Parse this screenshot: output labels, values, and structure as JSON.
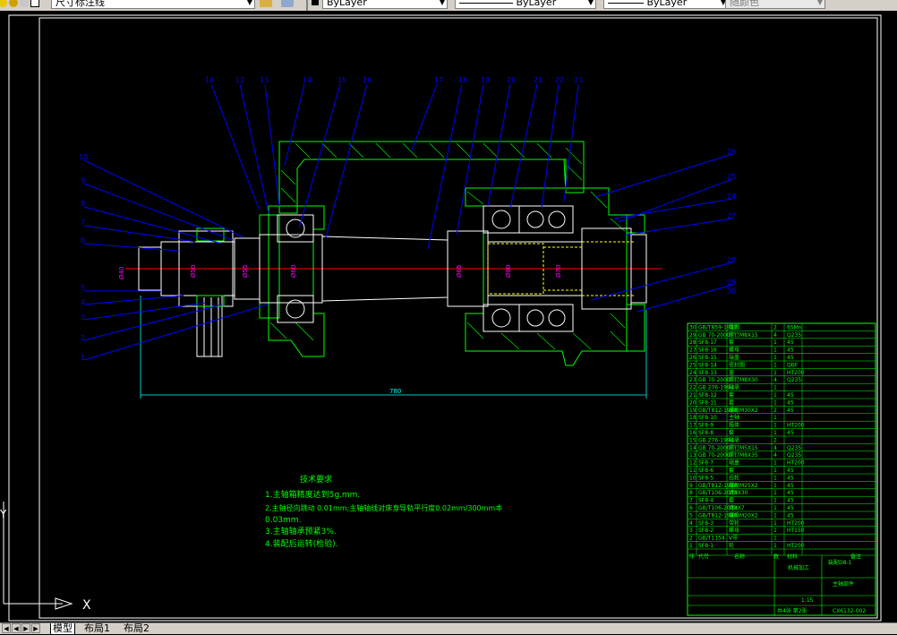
{
  "toolbar": {
    "text_style": "尺寸标注线",
    "layer": "ByLayer",
    "linetype": "ByLayer",
    "lineweight": "ByLayer",
    "color": "随颜色"
  },
  "drawing": {
    "balloons": [
      "10",
      "12",
      "13",
      "14",
      "15",
      "16",
      "17",
      "18",
      "19",
      "20",
      "21",
      "22",
      "23"
    ],
    "left_balloons": [
      "10",
      "9",
      "8",
      "7",
      "6",
      "5",
      "4",
      "3",
      "2",
      "1"
    ],
    "right_balloons": [
      "26",
      "25",
      "24",
      "27",
      "28",
      "29",
      "30"
    ],
    "dimension_overall": "780",
    "tech_title": "技术要求",
    "tech_lines": [
      "1.主轴箱精度达到5g.mm.",
      "2.主轴径向跳动 0.01mm;主轴轴线对床身导轨平行度0.02mm/300mm本",
      "0.03mm.",
      "3.主轴轴承预紧3%.",
      "4.装配后运转(检验)."
    ],
    "ucs_x": "X",
    "ucs_y": "Y"
  },
  "bom": {
    "rows": [
      [
        "30",
        "GB/T859-1987",
        "垫圈",
        "2",
        "65Mn"
      ],
      [
        "29",
        "GB 70-2000",
        "螺钉M8X15",
        "4",
        "Q235"
      ],
      [
        "28",
        "SF8-17",
        "套",
        "1",
        "45"
      ],
      [
        "27",
        "SF8-16",
        "螺母",
        "1",
        "45"
      ],
      [
        "26",
        "SF8-15",
        "端盖",
        "1",
        "45"
      ],
      [
        "25",
        "SF8-14",
        "密封圈",
        "1",
        "QBF"
      ],
      [
        "24",
        "SF8-13",
        "盖",
        "1",
        "HT200"
      ],
      [
        "23",
        "GB 70-2000",
        "螺钉M8X30",
        "4",
        "Q235"
      ],
      [
        "22",
        "GB 276-1994",
        "轴承",
        "1",
        ""
      ],
      [
        "21",
        "SF8-12",
        "套",
        "1",
        "45"
      ],
      [
        "20",
        "SF8-11",
        "套",
        "1",
        "45"
      ],
      [
        "19",
        "GB/T812-1988",
        "螺母M30X2",
        "2",
        "45"
      ],
      [
        "18",
        "SF8-10",
        "主轴",
        "1",
        ""
      ],
      [
        "17",
        "SF8-9",
        "箱体",
        "1",
        "HT200"
      ],
      [
        "16",
        "SF8-8",
        "套",
        "1",
        "45"
      ],
      [
        "15",
        "GB 276-1994",
        "轴承",
        "2",
        ""
      ],
      [
        "14",
        "GB 70-2000",
        "螺钉M5X15",
        "4",
        "Q235"
      ],
      [
        "13",
        "GB 70-2000",
        "螺钉M8X35",
        "4",
        "Q235"
      ],
      [
        "12",
        "SF8-7",
        "端盖",
        "1",
        "HT200"
      ],
      [
        "11",
        "SF8-6",
        "套",
        "1",
        "45"
      ],
      [
        "10",
        "SF8-5",
        "齿轮",
        "1",
        "45"
      ],
      [
        "9",
        "GB/T812-1988",
        "螺母M25X2",
        "1",
        "45"
      ],
      [
        "8",
        "GB/T106-2003",
        "键8X30",
        "1",
        "45"
      ],
      [
        "7",
        "SF8-4",
        "套",
        "1",
        "45"
      ],
      [
        "6",
        "GB/T106-2003",
        "键8X7",
        "1",
        "45"
      ],
      [
        "5",
        "GB/T812-1988",
        "螺母M20X2",
        "1",
        "45"
      ],
      [
        "4",
        "SF8-3",
        "带轮",
        "1",
        "HT200"
      ],
      [
        "3",
        "SF8-2",
        "螺母",
        "1",
        "HT150"
      ],
      [
        "2",
        "GB/T1154",
        "V带",
        "1",
        ""
      ],
      [
        "1",
        "SF8-1",
        "轮",
        "1",
        "HT200"
      ]
    ],
    "header": [
      "序",
      "代号",
      "名称",
      "数",
      "材料",
      "备注"
    ],
    "title_block": {
      "company": "机械加工",
      "drawing_no": "装配D8-1",
      "name": "主轴部件",
      "scale": "1:15",
      "sheet": "共4张 第2张",
      "code": "CX6132-002"
    }
  },
  "tabs": {
    "model": "模型",
    "layout1": "布局1",
    "layout2": "布局2"
  }
}
